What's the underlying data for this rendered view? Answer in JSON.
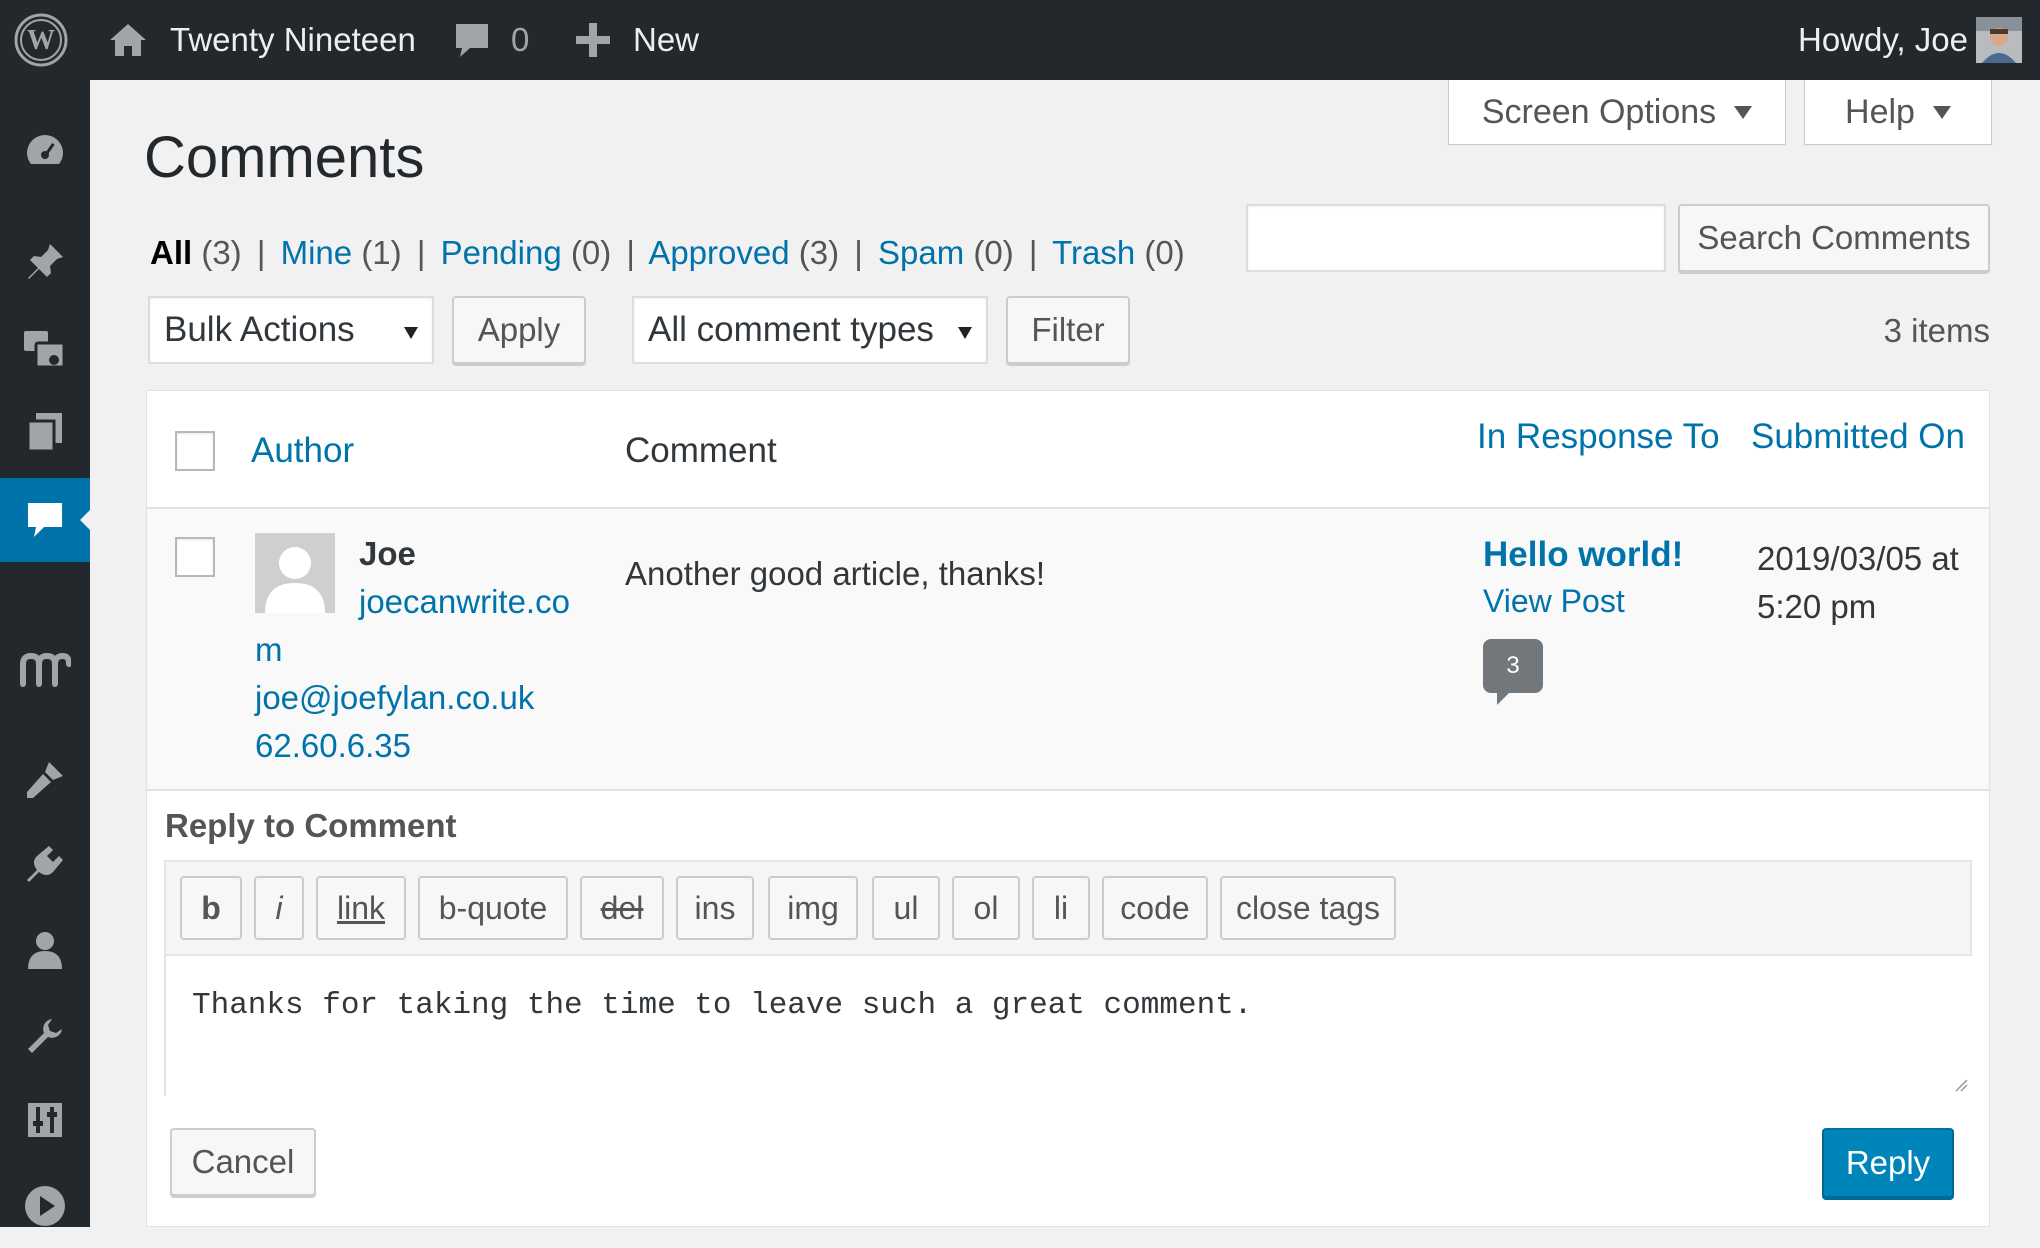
{
  "admin_bar": {
    "site_name": "Twenty Nineteen",
    "comments_count": "0",
    "new_label": "New",
    "howdy": "Howdy, Joe"
  },
  "header": {
    "screen_options": "Screen Options",
    "help": "Help",
    "page_title": "Comments"
  },
  "filters": {
    "all_label": "All",
    "all_count": "(3)",
    "mine_label": "Mine",
    "mine_count": "(1)",
    "pending_label": "Pending",
    "pending_count": "(0)",
    "approved_label": "Approved",
    "approved_count": "(3)",
    "spam_label": "Spam",
    "spam_count": "(0)",
    "trash_label": "Trash",
    "trash_count": "(0)",
    "separator": "|"
  },
  "search": {
    "value": "",
    "button": "Search Comments"
  },
  "tablenav": {
    "bulk_actions": "Bulk Actions",
    "apply": "Apply",
    "comment_types": "All comment types",
    "filter": "Filter",
    "items": "3 items"
  },
  "table": {
    "col_author": "Author",
    "col_comment": "Comment",
    "col_response": "In Response To",
    "col_submitted": "Submitted On"
  },
  "comment": {
    "author_name": "Joe",
    "author_url_line1": "joecanwrite.co",
    "author_url_line2": "m",
    "author_email": "joe@joefylan.co.uk",
    "author_ip": "62.60.6.35",
    "text": "Another good article, thanks!",
    "post_title": "Hello world!",
    "view_post": "View Post",
    "post_comment_count": "3",
    "date_line1": "2019/03/05 at",
    "date_line2": "5:20 pm"
  },
  "reply": {
    "heading": "Reply to Comment",
    "quicktags": [
      "b",
      "i",
      "link",
      "b-quote",
      "del",
      "ins",
      "img",
      "ul",
      "ol",
      "li",
      "code",
      "close tags"
    ],
    "textarea_value": "Thanks for taking the time to leave such a great comment.",
    "cancel": "Cancel",
    "submit": "Reply"
  },
  "colors": {
    "admin_bar_bg": "#23282d",
    "link": "#0073aa",
    "primary_button": "#0085ba",
    "current_menu": "#0073aa"
  },
  "icons": {
    "logo": "wordpress-logo-icon",
    "home": "home-icon",
    "comments": "comment-bubble-icon",
    "new": "plus-icon",
    "menu": [
      "dashboard-icon",
      "pin-icon",
      "media-icon",
      "pages-icon",
      "comments-icon",
      "memberpress-icon",
      "appearance-icon",
      "plugins-icon",
      "users-icon",
      "tools-icon",
      "settings-icon",
      "play-icon"
    ]
  }
}
